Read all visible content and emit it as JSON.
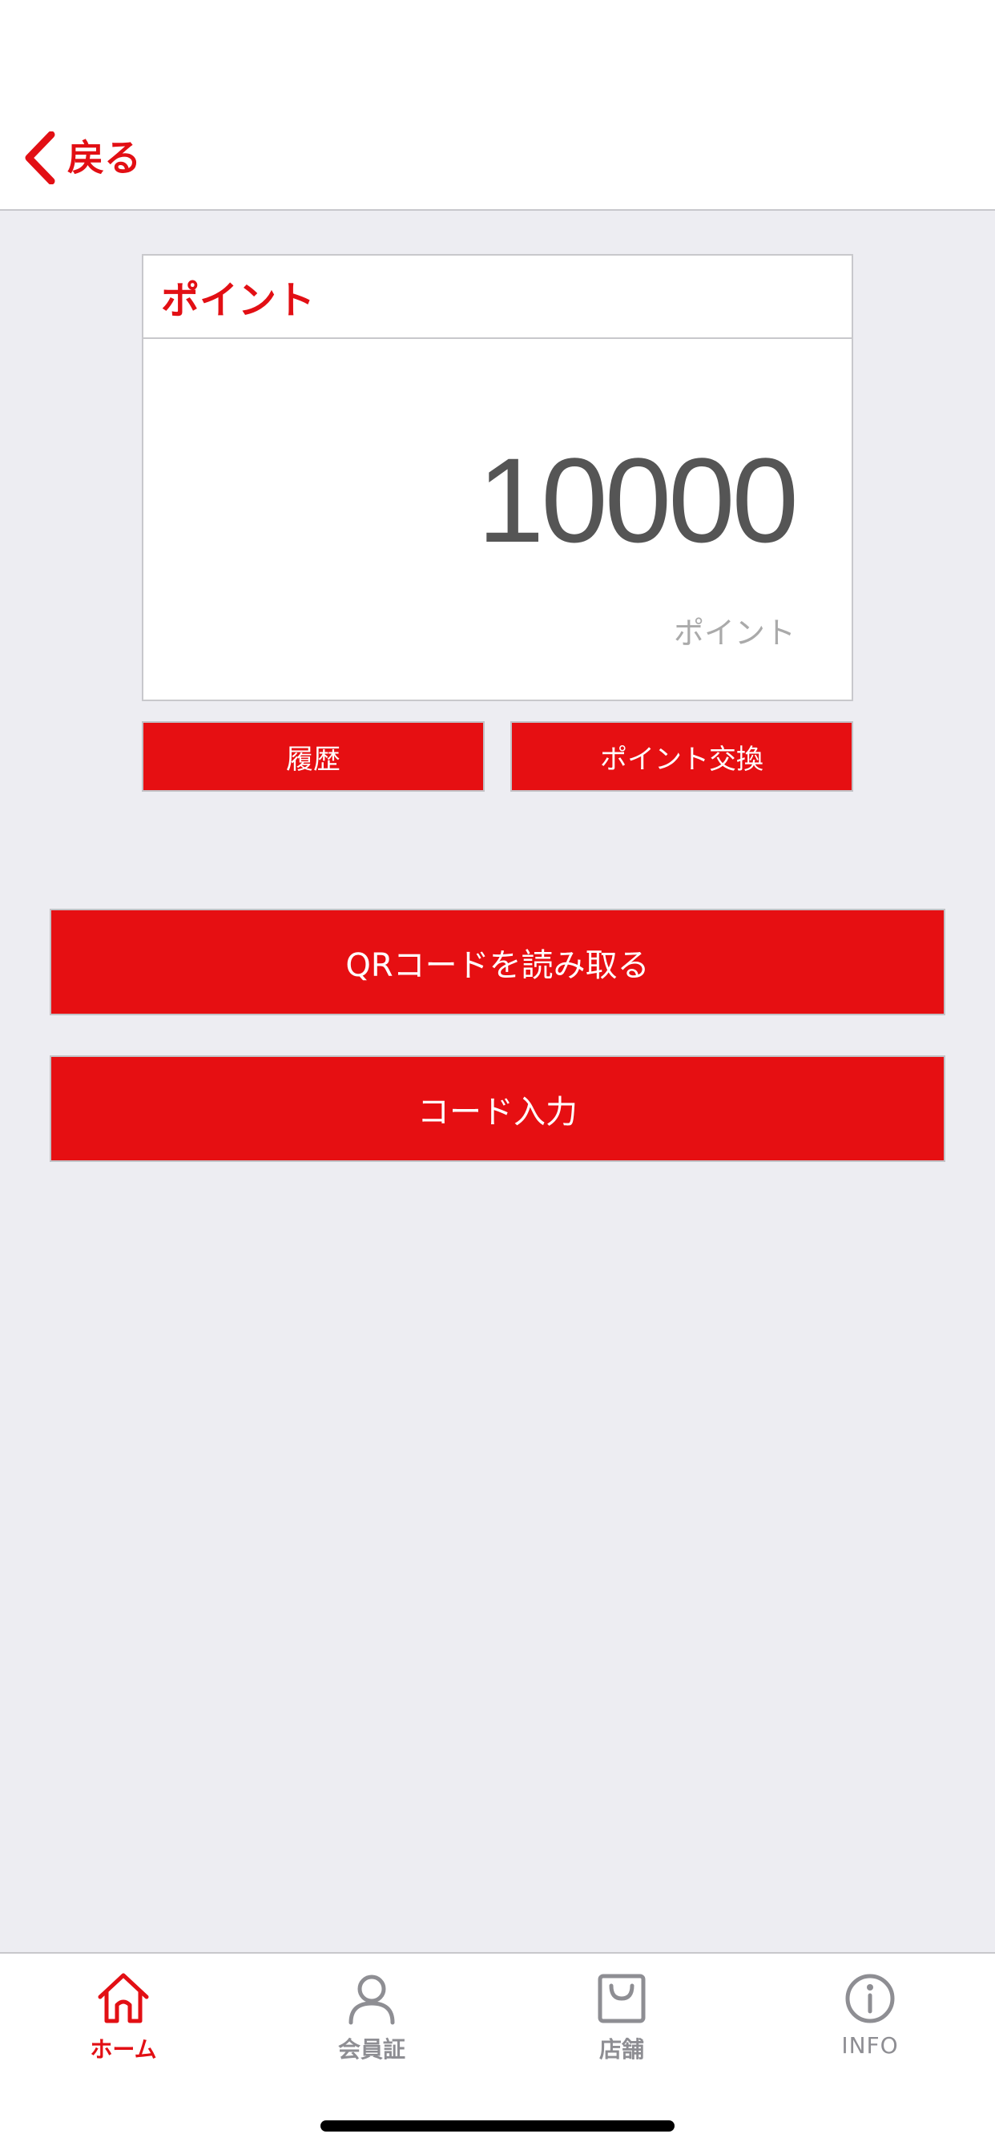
{
  "header": {
    "back_label": "戻る"
  },
  "points_card": {
    "title": "ポイント",
    "value": "10000",
    "unit": "ポイント"
  },
  "actions": {
    "history_label": "履歴",
    "exchange_label": "ポイント交換",
    "qr_label": "QRコードを読み取る",
    "code_label": "コード入力"
  },
  "tabbar": {
    "items": [
      {
        "label": "ホーム",
        "icon": "home-icon",
        "active": true
      },
      {
        "label": "会員証",
        "icon": "person-icon",
        "active": false
      },
      {
        "label": "店舗",
        "icon": "shopping-bag-icon",
        "active": false
      },
      {
        "label": "INFO",
        "icon": "info-icon",
        "active": false
      }
    ]
  },
  "colors": {
    "accent": "#e60f12",
    "background": "#ededf2",
    "inactive": "#8e8e93"
  }
}
